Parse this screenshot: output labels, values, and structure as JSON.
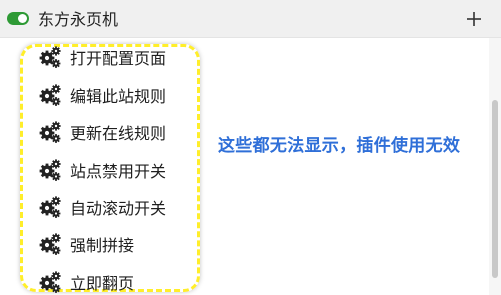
{
  "header": {
    "title": "东方永页机",
    "toggle_state": "on",
    "add_button": "+"
  },
  "menu": {
    "icon": "gears-icon",
    "items": [
      {
        "label": "打开配置页面"
      },
      {
        "label": "编辑此站规则"
      },
      {
        "label": "更新在线规则"
      },
      {
        "label": "站点禁用开关"
      },
      {
        "label": "自动滚动开关"
      },
      {
        "label": "强制拼接"
      },
      {
        "label": "立即翻页"
      }
    ]
  },
  "annotation": {
    "text": "这些都无法显示，插件使用无效"
  },
  "colors": {
    "toggle": "#2e9a35",
    "highlight_border": "#ffee2a",
    "annotation": "#2f6fd8"
  }
}
